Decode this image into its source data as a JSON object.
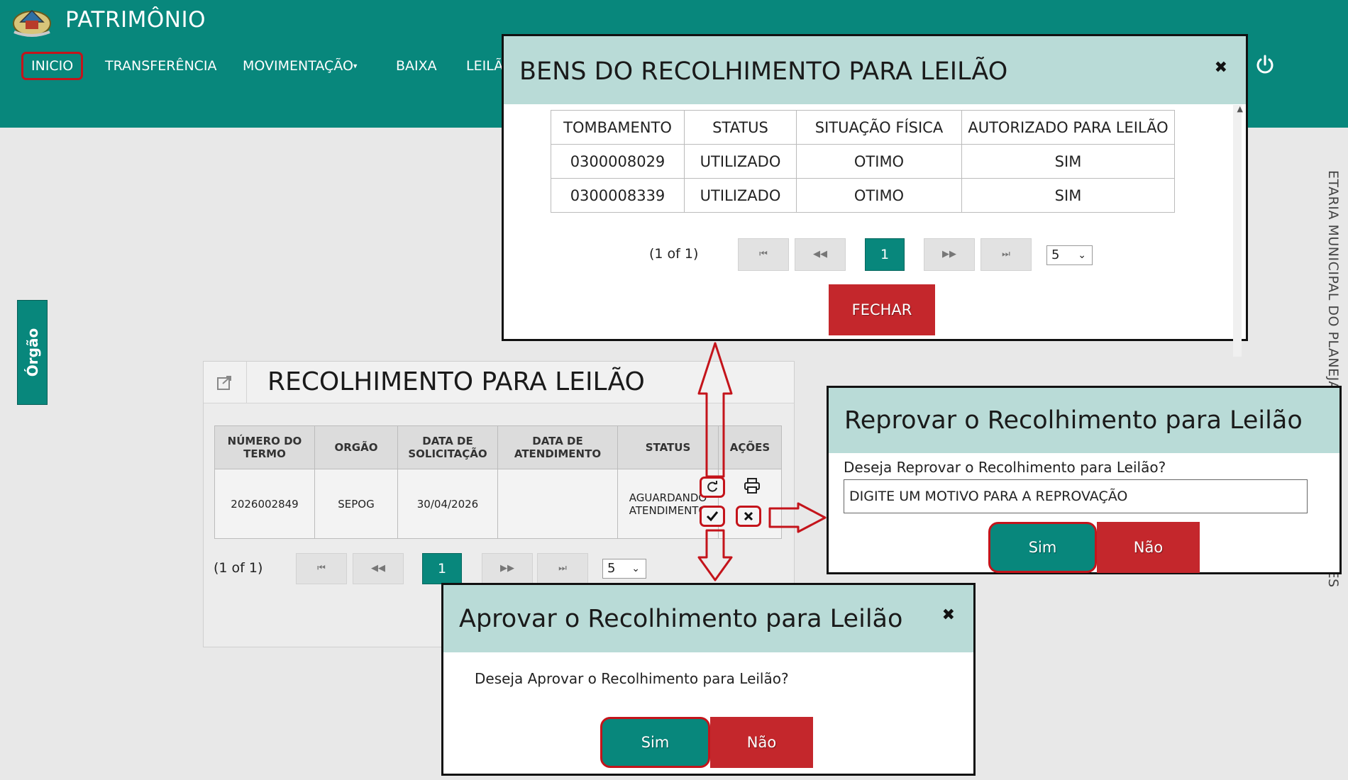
{
  "header": {
    "app_title": "PATRIMÔNIO",
    "nav": [
      {
        "label": "INICIO"
      },
      {
        "label": "TRANSFERÊNCIA"
      },
      {
        "label": "MOVIMENTAÇÃO"
      },
      {
        "label": "BAIXA"
      },
      {
        "label": "LEILÃ"
      }
    ],
    "power_icon": "power-icon"
  },
  "sidebar": {
    "tab_label": "Órgão"
  },
  "side_text": "ETARIA MUNICIPAL DO PLANEJAMENTO, ORÇAMENTO E GES",
  "panel": {
    "title": "RECOLHIMENTO PARA LEILÃO",
    "columns": [
      "NÚMERO DO TERMO",
      "ORGÃO",
      "DATA DE SOLICITAÇÃO",
      "DATA DE ATENDIMENTO",
      "STATUS",
      "AÇÕES"
    ],
    "rows": [
      {
        "numero": "2026002849",
        "orgao": "SEPOG",
        "data_solicitacao": "30/04/2026",
        "data_atendimento": "",
        "status": "AGUARDANDO ATENDIMENTO"
      }
    ],
    "actions": [
      "refresh-icon",
      "print-icon",
      "check-icon",
      "close-icon"
    ],
    "paginator": {
      "label": "(1 of 1)",
      "first": "⏮",
      "prev": "◀◀",
      "current": "1",
      "next": "▶▶",
      "last": "⏭",
      "rows_per_page": "5"
    }
  },
  "bens_modal": {
    "title": "BENS DO RECOLHIMENTO PARA LEILÃO",
    "columns": [
      "TOMBAMENTO",
      "STATUS",
      "SITUAÇÃO FÍSICA",
      "AUTORIZADO PARA LEILÃO"
    ],
    "rows": [
      {
        "tombamento": "0300008029",
        "status": "UTILIZADO",
        "situacao": "OTIMO",
        "autorizado": "SIM"
      },
      {
        "tombamento": "0300008339",
        "status": "UTILIZADO",
        "situacao": "OTIMO",
        "autorizado": "SIM"
      }
    ],
    "paginator": {
      "label": "(1 of 1)",
      "first": "⏮",
      "prev": "◀◀",
      "current": "1",
      "next": "▶▶",
      "last": "⏭",
      "rows_per_page": "5"
    },
    "fechar_label": "FECHAR"
  },
  "reprovar_modal": {
    "title": "Reprovar o Recolhimento para Leilão",
    "question": "Deseja Reprovar o Recolhimento para Leilão?",
    "input_placeholder": "DIGITE UM MOTIVO PARA A REPROVAÇÃO",
    "sim_label": "Sim",
    "nao_label": "Não"
  },
  "aprovar_modal": {
    "title": "Aprovar o Recolhimento para Leilão",
    "question": "Deseja Aprovar o Recolhimento para Leilão?",
    "sim_label": "Sim",
    "nao_label": "Não"
  },
  "colors": {
    "primary": "#08877c",
    "danger": "#c4272c",
    "highlight": "#c4141b",
    "modal_header": "#b9dbd7"
  }
}
